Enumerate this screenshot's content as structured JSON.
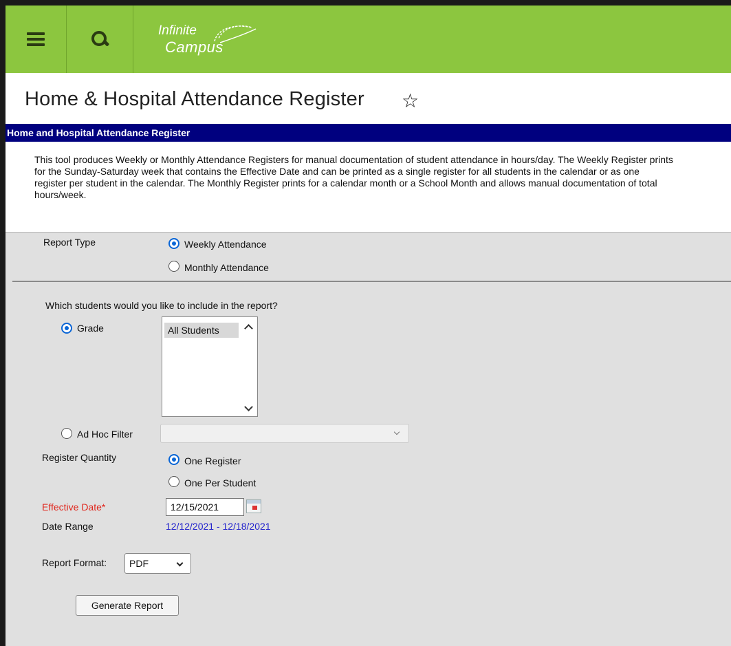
{
  "header": {
    "menu_icon": "hamburger-menu-icon",
    "search_icon": "search-icon",
    "logo_line1": "Infinite",
    "logo_line2": "Campus",
    "brand_color": "#8cc63f"
  },
  "page": {
    "title": "Home & Hospital Attendance Register",
    "favorite_icon": "star-outline-icon"
  },
  "section": {
    "header": "Home and Hospital Attendance Register",
    "header_color": "#00007f",
    "description": "This tool produces Weekly or Monthly Attendance Registers for manual documentation of student attendance in hours/day. The Weekly Register prints for the Sunday-Saturday week that contains the Effective Date and can be printed as a single register for all students in the calendar or as one register per student in the calendar. The Monthly Register prints for a calendar month or a School Month and allows manual documentation of total hours/week."
  },
  "form": {
    "report_type_label": "Report Type",
    "report_type_options": [
      {
        "label": "Weekly Attendance",
        "selected": true
      },
      {
        "label": "Monthly Attendance",
        "selected": false
      }
    ],
    "include_question": "Which students would you like to include in the report?",
    "grade_label": "Grade",
    "grade_selected": true,
    "grade_list": [
      "All Students"
    ],
    "adhoc_label": "Ad Hoc Filter",
    "adhoc_selected": false,
    "adhoc_value": "",
    "register_quantity_label": "Register Quantity",
    "register_quantity_options": [
      {
        "label": "One Register",
        "selected": true
      },
      {
        "label": "One Per Student",
        "selected": false
      }
    ],
    "effective_date_label": "Effective Date*",
    "effective_date_value": "12/15/2021",
    "date_range_label": "Date Range",
    "date_range_value": "12/12/2021 - 12/18/2021",
    "report_format_label": "Report Format:",
    "report_format_value": "PDF",
    "generate_button": "Generate Report"
  }
}
